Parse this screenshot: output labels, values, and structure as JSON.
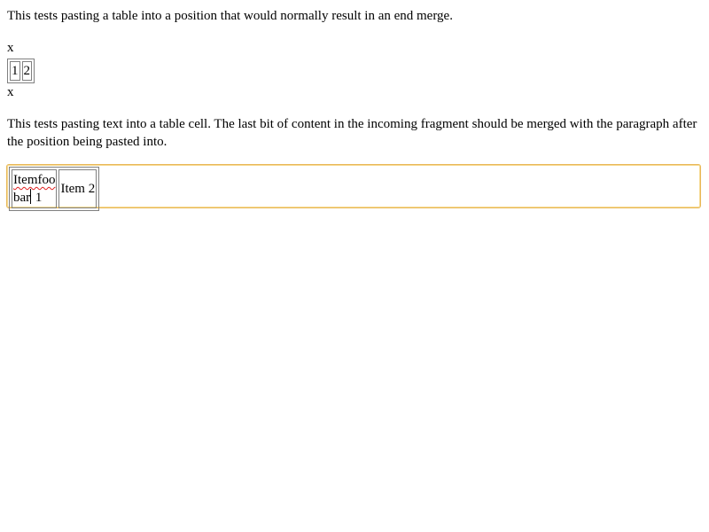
{
  "intro_paragraph": "This tests pasting a table into a position that would normally result in an end merge.",
  "marker_before": "x",
  "small_table": {
    "cells": [
      "1",
      "2"
    ]
  },
  "marker_after": "x",
  "second_paragraph": "This tests pasting text into a table cell. The last bit of content in the incoming fragment should be merged with the paragraph after the position being pasted into.",
  "editable_table": {
    "cell1_line1": "Itemfoo",
    "cell1_line2_before_caret": "bar",
    "cell1_line2_after_caret": " 1",
    "cell2": "Item 2"
  },
  "colors": {
    "focus_border": "#e8b85a",
    "spellcheck": "#e02020"
  }
}
